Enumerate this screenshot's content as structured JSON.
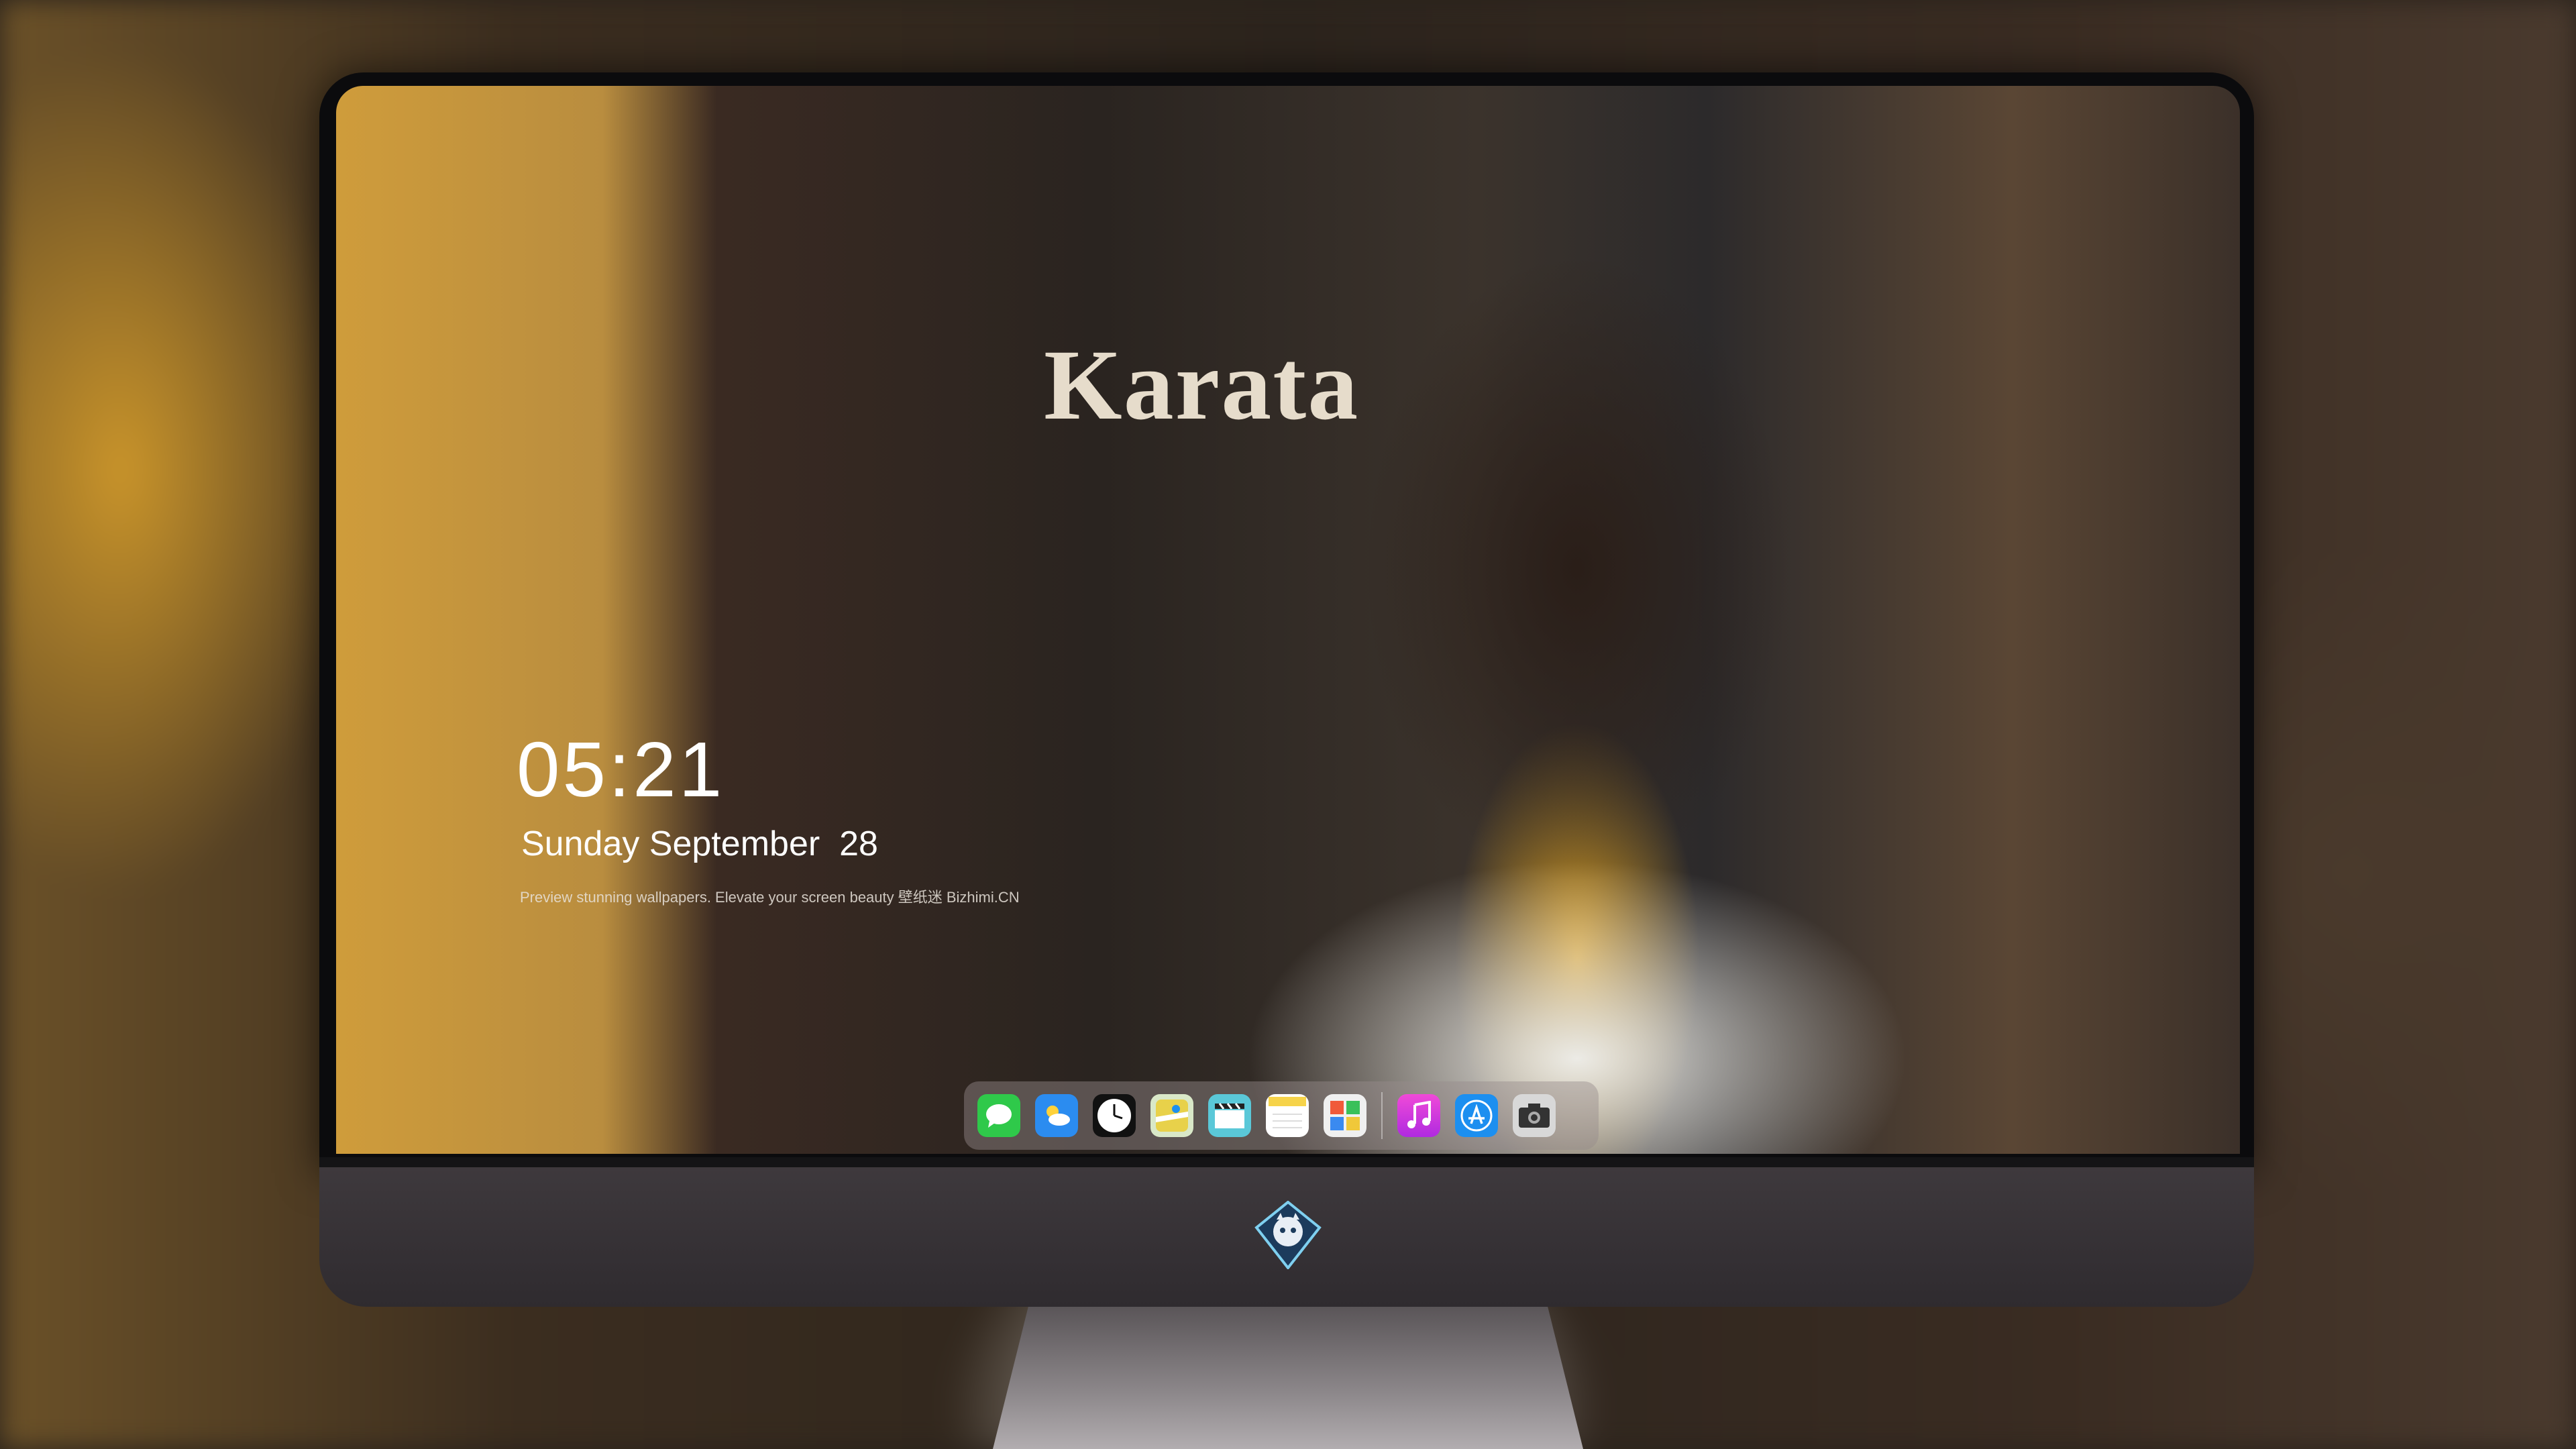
{
  "wallpaper": {
    "poster_text": "Karata"
  },
  "lockscreen": {
    "time": "05:21",
    "date": "Sunday September  28",
    "tagline": "Preview stunning wallpapers. Elevate your screen beauty  壁纸迷   Bizhimi.CN"
  },
  "dock": {
    "items": [
      {
        "name": "messages",
        "glyph": "💬",
        "color": "#2fc94a"
      },
      {
        "name": "weather",
        "glyph": "⛅",
        "color": "#2b8cf0"
      },
      {
        "name": "clock",
        "glyph": "🕐",
        "color": "#ffffff"
      },
      {
        "name": "maps",
        "glyph": "🗺",
        "color": "#e8d14a"
      },
      {
        "name": "clips",
        "glyph": "🎬",
        "color": "#5ac8d8"
      },
      {
        "name": "notes",
        "glyph": "📝",
        "color": "#f6d34a"
      },
      {
        "name": "photos",
        "glyph": "🖼",
        "color": "#f0f0f0"
      },
      {
        "name": "music",
        "glyph": "♫",
        "color": "#e03ad2"
      },
      {
        "name": "app-store",
        "glyph": "Ⓐ",
        "color": "#1c8ff0"
      },
      {
        "name": "camera",
        "glyph": "📷",
        "color": "#4a4a4a"
      }
    ]
  }
}
